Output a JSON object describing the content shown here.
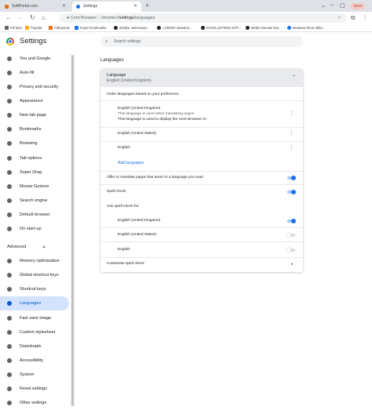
{
  "tabs": [
    {
      "title": "SoftPortal.com",
      "active": false
    },
    {
      "title": "Settings",
      "active": true
    }
  ],
  "window": {
    "error_label": "Error"
  },
  "toolbar": {
    "site_name": "Cent Browser",
    "url_prefix": "chrome://",
    "url_path": "settings",
    "url_suffix": "/languages"
  },
  "bookmarks": [
    {
      "label": "Kill tabs",
      "color": "#5f6368"
    },
    {
      "label": "Popular",
      "color": "#f9ab00"
    },
    {
      "label": "AliExpress",
      "color": "#e8710a"
    },
    {
      "label": "Import bookmarks",
      "color": "#1a73e8"
    },
    {
      "label": "dzialka. Warszawa...",
      "color": "#202124"
    },
    {
      "label": "=100000 Экземпл...",
      "color": "#202124"
    },
    {
      "label": "EKSKLUZYWNA DYP...",
      "color": "#202124"
    },
    {
      "label": "Meble biurowe biur...",
      "color": "#202124"
    },
    {
      "label": "Montana Dinon Bika...",
      "color": "#1a73e8"
    }
  ],
  "header": {
    "title": "Settings",
    "search_placeholder": "Search settings"
  },
  "sidebar": {
    "items": [
      {
        "label": "You and Google",
        "icon": "person-icon"
      },
      {
        "label": "Auto-fill",
        "icon": "autofill-icon"
      },
      {
        "label": "Privacy and security",
        "icon": "shield-icon"
      },
      {
        "label": "Appearance",
        "icon": "palette-icon"
      },
      {
        "label": "New tab page",
        "icon": "newtab-icon"
      },
      {
        "label": "Bookmarks",
        "icon": "bookmark-icon"
      },
      {
        "label": "Browsing",
        "icon": "browsing-icon"
      },
      {
        "label": "Tab options",
        "icon": "tab-icon"
      },
      {
        "label": "Super Drag",
        "icon": "drag-icon"
      },
      {
        "label": "Mouse Gesture",
        "icon": "mouse-icon"
      },
      {
        "label": "Search engine",
        "icon": "search-icon"
      },
      {
        "label": "Default browser",
        "icon": "browser-icon"
      },
      {
        "label": "On start-up",
        "icon": "power-icon"
      }
    ],
    "advanced_label": "Advanced",
    "advanced_items": [
      {
        "label": "Memory optimization",
        "icon": "memory-icon",
        "selected": false
      },
      {
        "label": "Global shortcut keys",
        "icon": "keyboard-icon",
        "selected": false
      },
      {
        "label": "Shortcut keys",
        "icon": "keyboard-icon",
        "selected": false
      },
      {
        "label": "Languages",
        "icon": "globe-icon",
        "selected": true
      },
      {
        "label": "Fast save image",
        "icon": "image-icon",
        "selected": false
      },
      {
        "label": "Custom stylesheet",
        "icon": "css-icon",
        "selected": false
      },
      {
        "label": "Downloads",
        "icon": "download-icon",
        "selected": false
      },
      {
        "label": "Accessibility",
        "icon": "accessibility-icon",
        "selected": false
      },
      {
        "label": "System",
        "icon": "wrench-icon",
        "selected": false
      },
      {
        "label": "Reset settings",
        "icon": "reset-icon",
        "selected": false
      },
      {
        "label": "Other settings",
        "icon": "gear-icon",
        "selected": false
      }
    ]
  },
  "languages": {
    "heading": "Languages",
    "card_title": "Language",
    "card_subtitle": "English (United Kingdom)",
    "order_label": "Order languages based on your preference",
    "list": [
      {
        "name": "English (United Kingdom)",
        "notes": [
          "This language is used when translating pages",
          "This language is used to display the Cent Browser UI"
        ]
      },
      {
        "name": "English (United States)",
        "notes": []
      },
      {
        "name": "English",
        "notes": []
      }
    ],
    "add_languages": "Add languages",
    "offer_translate": "Offer to translate pages that aren't in a language you read",
    "offer_translate_on": true,
    "spell_check": "Spell check",
    "spell_check_on": true,
    "use_spell_check_for": "Use spell check for",
    "spell_langs": [
      {
        "name": "English (United Kingdom)",
        "on": true
      },
      {
        "name": "English (United States)",
        "on": false
      },
      {
        "name": "English",
        "on": false
      }
    ],
    "customise": "Customise spell check"
  }
}
